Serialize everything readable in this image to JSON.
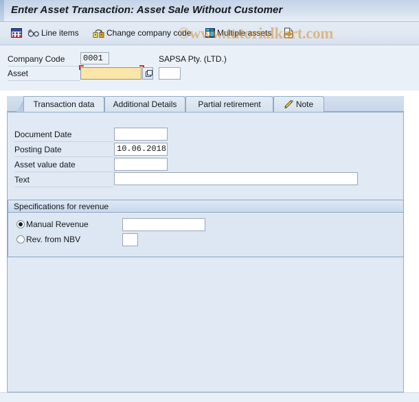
{
  "window": {
    "title": "Enter Asset Transaction: Asset Sale Without Customer"
  },
  "toolbar": {
    "items": [
      {
        "icon": "report-icon",
        "label": ""
      },
      {
        "icon": "glasses-icon",
        "label": "Line items"
      },
      {
        "icon": "change-company-code-icon",
        "label": "Change company code"
      },
      {
        "icon": "grid-icon",
        "label": "Multiple assets"
      },
      {
        "icon": "document-arrow-icon",
        "label": ""
      }
    ]
  },
  "watermark": {
    "text": "©www.tutorialkart.com"
  },
  "header": {
    "company_code_label": "Company Code",
    "company_code_value": "0001",
    "company_name": "SAPSA Pty. (LTD.)",
    "asset_label": "Asset",
    "asset_value": "",
    "asset_placeholder": "",
    "asset_subnumber_value": ""
  },
  "tabs": [
    {
      "label": "Transaction data",
      "active": true,
      "icon": null
    },
    {
      "label": "Additional Details",
      "active": false,
      "icon": null
    },
    {
      "label": "Partial retirement",
      "active": false,
      "icon": null
    },
    {
      "label": "Note",
      "active": false,
      "icon": "pencil-icon"
    }
  ],
  "form": {
    "fields": [
      {
        "label": "Document Date",
        "value": ""
      },
      {
        "label": "Posting Date",
        "value": "10.06.2018"
      },
      {
        "label": "Asset value date",
        "value": ""
      },
      {
        "label": "Text",
        "value": ""
      }
    ]
  },
  "revenue_group": {
    "title": "Specifications for revenue",
    "options": [
      {
        "label": "Manual Revenue",
        "selected": true,
        "value": ""
      },
      {
        "label": "Rev. from NBV",
        "selected": false,
        "value": ""
      }
    ]
  },
  "colors": {
    "title_bar": "#c3d4e8",
    "panel_bg": "#e0e9f4",
    "focus_field": "#fbe6a8",
    "required_marker": "#d52b1e",
    "watermark": "#d69231"
  }
}
